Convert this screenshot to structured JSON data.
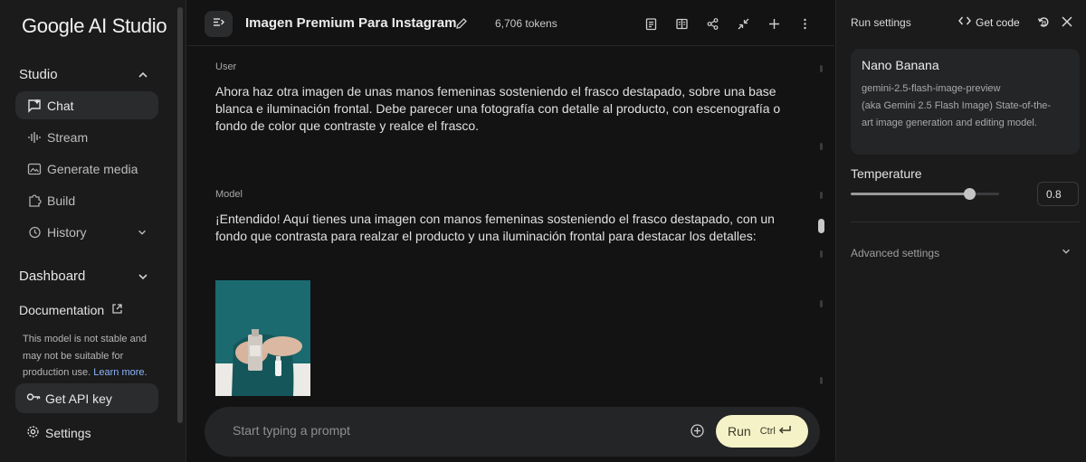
{
  "sidebar": {
    "logo": "Google AI Studio",
    "studio_label": "Studio",
    "items": [
      {
        "label": "Chat",
        "icon": "chat-icon",
        "active": true
      },
      {
        "label": "Stream",
        "icon": "waveform-icon"
      },
      {
        "label": "Generate media",
        "icon": "media-icon"
      },
      {
        "label": "Build",
        "icon": "puzzle-icon"
      },
      {
        "label": "History",
        "icon": "history-icon"
      }
    ],
    "dashboard_label": "Dashboard",
    "documentation_label": "Documentation",
    "note_text": "This model is not stable and may not be suitable for production use.",
    "note_link": "Learn more.",
    "api_key_label": "Get API key",
    "settings_label": "Settings"
  },
  "topbar": {
    "title": "Imagen Premium Para Instagram",
    "tokens": "6,706 tokens",
    "icons": [
      "compare-icon",
      "columns-icon",
      "share-icon",
      "compress-icon",
      "plus-icon",
      "more-vert-icon"
    ]
  },
  "chat": {
    "messages": [
      {
        "role": "User",
        "text": "Ahora haz otra imagen de unas manos femeninas sosteniendo el frasco destapado, sobre una base blanca e iluminación frontal. Debe parecer una fotografía con detalle al producto, con escenografía o fondo de color que contraste y realce el frasco."
      },
      {
        "role": "Model",
        "text": "¡Entendido! Aquí tienes una imagen con manos femeninas sosteniendo el frasco destapado, con un fondo que contrasta para realzar el producto y una iluminación frontal para destacar los detalles:"
      }
    ],
    "prompt_placeholder": "Start typing a prompt",
    "run_label": "Run",
    "run_hint": "Ctrl"
  },
  "right_panel": {
    "title": "Run settings",
    "get_code_label": "Get code",
    "model_name": "Nano Banana",
    "model_id": "gemini-2.5-flash-image-preview",
    "model_desc": "(aka Gemini 2.5 Flash Image) State-of-the-art image generation and editing model.",
    "temperature_label": "Temperature",
    "temperature_value": "0.8",
    "temperature_fraction": 0.8,
    "advanced_label": "Advanced settings"
  },
  "colors": {
    "background": "#131314",
    "panel": "#1b1b1c",
    "run_button": "#f6f2c7",
    "link": "#8ab4f8",
    "image_bg": "#1a6a6f"
  }
}
